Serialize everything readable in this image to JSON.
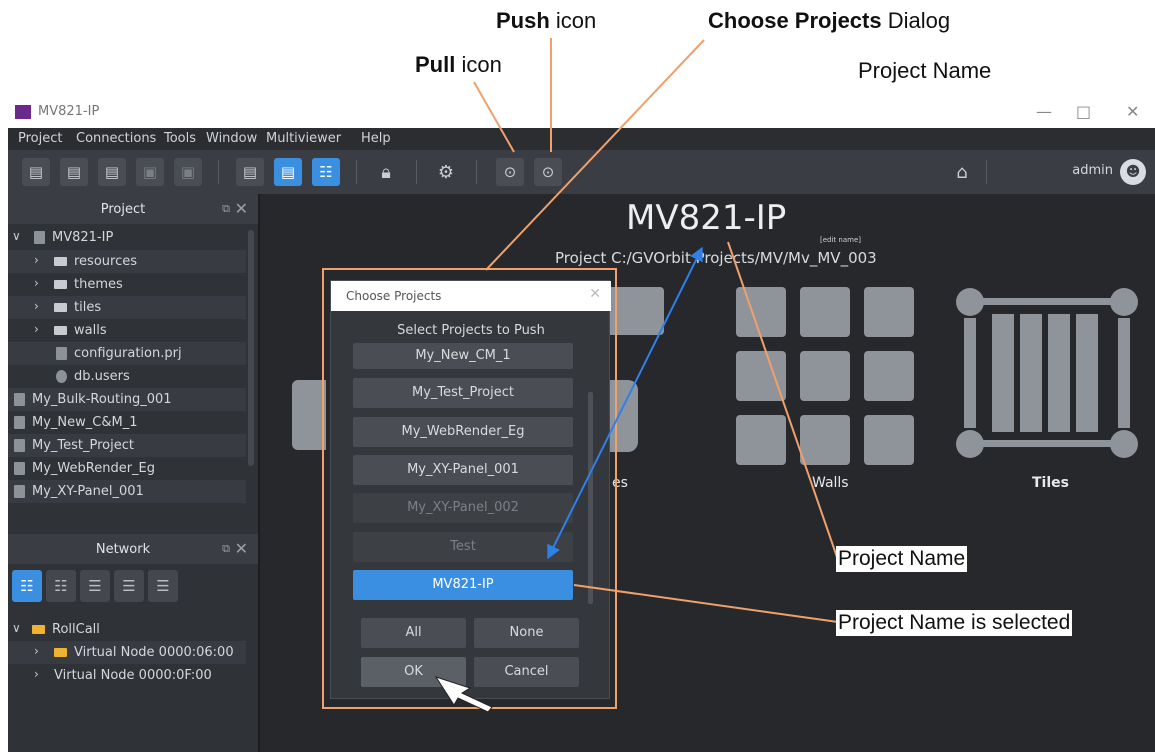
{
  "callouts": {
    "push_bold": "Push",
    "push_rest": " icon",
    "pull_bold": "Pull",
    "pull_rest": " icon",
    "choose_bold": "Choose Projects",
    "choose_rest": " Dialog",
    "project_name_top": "Project Name",
    "project_name_mid": "Project Name",
    "project_name_selected": "Project Name is selected"
  },
  "window": {
    "title": "MV821-IP",
    "minimize": "—",
    "maximize": "□",
    "close": "✕"
  },
  "menu": [
    "Project",
    "Connections",
    "Tools",
    "Window",
    "Multiviewer",
    "Help"
  ],
  "toolbar": {
    "user": "admin",
    "icons": [
      "new-project-icon",
      "import-project-icon",
      "export-project-icon",
      "save-icon",
      "save-as-icon",
      "deploy-icon",
      "project-view-icon",
      "network-view-icon",
      "lock-icon",
      "settings-icon",
      "pull-icon",
      "push-icon",
      "home-icon",
      "user-icon"
    ]
  },
  "project_panel": {
    "title": "Project",
    "tree": [
      {
        "label": "MV821-IP",
        "level": 0,
        "icon": "project-icon",
        "chevron": "v"
      },
      {
        "label": "resources",
        "level": 1,
        "icon": "folder-icon",
        "chevron": ">"
      },
      {
        "label": "themes",
        "level": 1,
        "icon": "folder-icon",
        "chevron": ">"
      },
      {
        "label": "tiles",
        "level": 1,
        "icon": "folder-icon",
        "chevron": ">"
      },
      {
        "label": "walls",
        "level": 1,
        "icon": "folder-icon",
        "chevron": ">"
      },
      {
        "label": "configuration.prj",
        "level": 2,
        "icon": "file-icon",
        "chevron": ""
      },
      {
        "label": "db.users",
        "level": 2,
        "icon": "users-icon",
        "chevron": ""
      },
      {
        "label": "My_Bulk-Routing_001",
        "level": 0,
        "icon": "project-icon",
        "chevron": ""
      },
      {
        "label": "My_New_C&M_1",
        "level": 0,
        "icon": "project-icon",
        "chevron": ""
      },
      {
        "label": "My_Test_Project",
        "level": 0,
        "icon": "project-icon",
        "chevron": ""
      },
      {
        "label": "My_WebRender_Eg",
        "level": 0,
        "icon": "project-icon",
        "chevron": ""
      },
      {
        "label": "My_XY-Panel_001",
        "level": 0,
        "icon": "project-icon",
        "chevron": ""
      }
    ]
  },
  "network_panel": {
    "title": "Network",
    "tree": [
      {
        "label": "RollCall",
        "level": 0,
        "chevron": "v"
      },
      {
        "label": "Virtual Node 0000:06:00",
        "level": 1,
        "chevron": ">"
      },
      {
        "label": "Virtual Node 0000:0F:00",
        "level": 1,
        "chevron": ">"
      }
    ]
  },
  "main": {
    "project_name": "MV821-IP",
    "edit_name": "[edit name]",
    "project_path": "Project C:/GVOrbit Projects/MV/Mv_MV_003",
    "cards": [
      "Walls",
      "Tiles"
    ],
    "partial_card": "es"
  },
  "dialog": {
    "title": "Choose Projects",
    "prompt": "Select Projects to Push",
    "projects": [
      {
        "label": "My_New_CM_1",
        "state": "normal"
      },
      {
        "label": "My_Test_Project",
        "state": "normal"
      },
      {
        "label": "My_WebRender_Eg",
        "state": "normal"
      },
      {
        "label": "My_XY-Panel_001",
        "state": "normal"
      },
      {
        "label": "My_XY-Panel_002",
        "state": "disabled"
      },
      {
        "label": "Test",
        "state": "disabled"
      },
      {
        "label": "MV821-IP",
        "state": "selected"
      }
    ],
    "all_label": "All",
    "none_label": "None",
    "ok_label": "OK",
    "cancel_label": "Cancel"
  },
  "colors": {
    "accent": "#3b8fe0",
    "callout_line": "#f0a06a",
    "arrow_blue": "#2f80e8"
  }
}
